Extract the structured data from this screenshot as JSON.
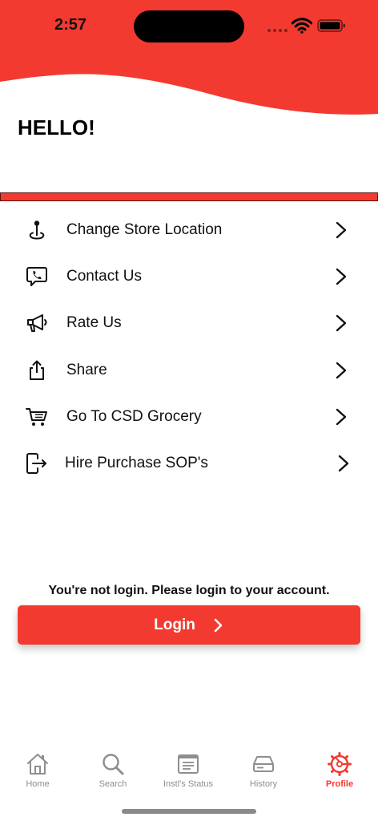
{
  "status_bar": {
    "time": "2:57"
  },
  "header": {
    "greeting": "HELLO!"
  },
  "menu": {
    "items": [
      {
        "label": "Change Store Location",
        "icon": "location-pin-icon"
      },
      {
        "label": "Contact Us",
        "icon": "chat-phone-icon"
      },
      {
        "label": "Rate Us",
        "icon": "megaphone-icon"
      },
      {
        "label": "Share",
        "icon": "share-icon"
      },
      {
        "label": "Go To CSD Grocery",
        "icon": "shopping-cart-icon"
      },
      {
        "label": "Hire Purchase SOP's",
        "icon": "logout-arrow-icon"
      }
    ]
  },
  "login": {
    "message": "You're not login. Please login to your account.",
    "button_label": "Login"
  },
  "tabbar": {
    "active": "Profile",
    "tabs": [
      {
        "label": "Home",
        "icon": "house-icon"
      },
      {
        "label": "Search",
        "icon": "magnifier-icon"
      },
      {
        "label": "Instl's Status",
        "icon": "document-list-icon"
      },
      {
        "label": "History",
        "icon": "drive-stack-icon"
      },
      {
        "label": "Profile",
        "icon": "profile-gear-icon"
      }
    ]
  },
  "colors": {
    "accent": "#f33a30",
    "text": "#111111",
    "inactive": "#8e8e8e"
  }
}
